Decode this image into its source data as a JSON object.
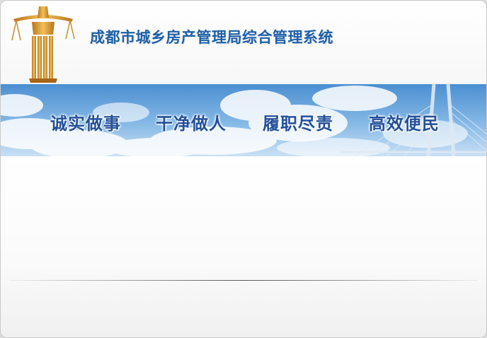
{
  "header": {
    "title": "成都市城乡房产管理局综合管理系统",
    "emblem_icon": "golden-scale-emblem-icon"
  },
  "banner": {
    "mottos": [
      "诚实做事",
      "干净做人",
      "履职尽责",
      "高效便民"
    ]
  },
  "colors": {
    "title": "#1e5fa8",
    "motto": "#24509a",
    "sky_top": "#4b8fd2",
    "emblem_gold": "#d79a2c"
  }
}
